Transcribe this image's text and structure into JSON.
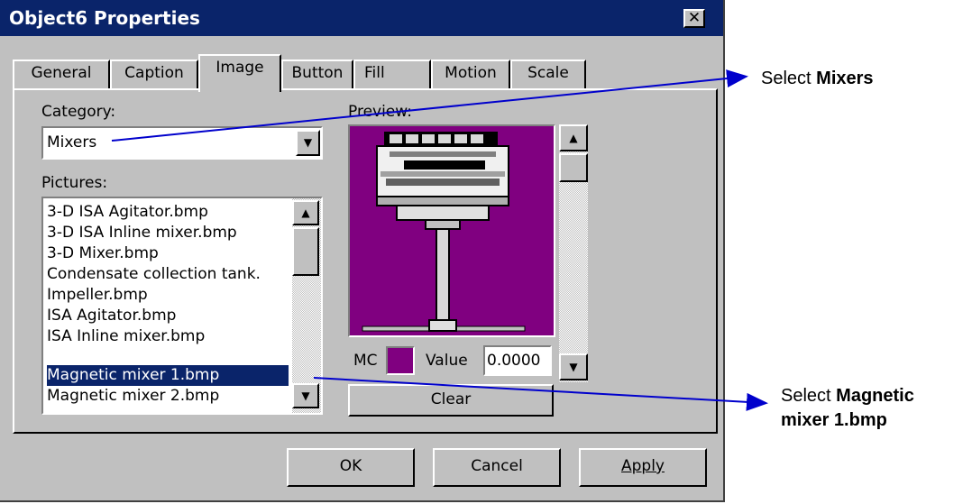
{
  "window": {
    "title": "Object6 Properties",
    "close_glyph": "✕"
  },
  "tabs": [
    {
      "label": "General"
    },
    {
      "label": "Caption"
    },
    {
      "label": "Image"
    },
    {
      "label": "Button"
    },
    {
      "label": "Fill"
    },
    {
      "label": "Motion"
    },
    {
      "label": "Scale"
    }
  ],
  "active_tab": "Image",
  "category": {
    "label": "Category:",
    "value": "Mixers"
  },
  "pictures": {
    "label": "Pictures:",
    "items": [
      "3-D ISA Agitator.bmp",
      "3-D ISA Inline mixer.bmp",
      "3-D Mixer.bmp",
      "Condensate collection tank.",
      "Impeller.bmp",
      "ISA Agitator.bmp",
      "ISA Inline mixer.bmp",
      "Magnetic mixer 1.bmp",
      "Magnetic mixer 2.bmp"
    ],
    "selected_index": 7
  },
  "preview": {
    "label": "Preview:",
    "background": "#800080",
    "mc_label": "MC",
    "mc_color": "#800080",
    "value_label": "Value",
    "value": "0.0000",
    "clear_label": "Clear"
  },
  "buttons": {
    "ok": "OK",
    "cancel": "Cancel",
    "apply": "Apply"
  },
  "annotations": {
    "select_mixers": {
      "prefix": "Select ",
      "bold": "Mixers"
    },
    "select_magnetic": {
      "prefix": "Select ",
      "bold_line1": "Magnetic",
      "bold_line2": "mixer 1.bmp"
    },
    "arrow_color": "#0000cc"
  },
  "icons": [
    "close-icon",
    "dropdown-arrow-icon",
    "scroll-up-icon",
    "scroll-down-icon",
    "mixer-image"
  ]
}
